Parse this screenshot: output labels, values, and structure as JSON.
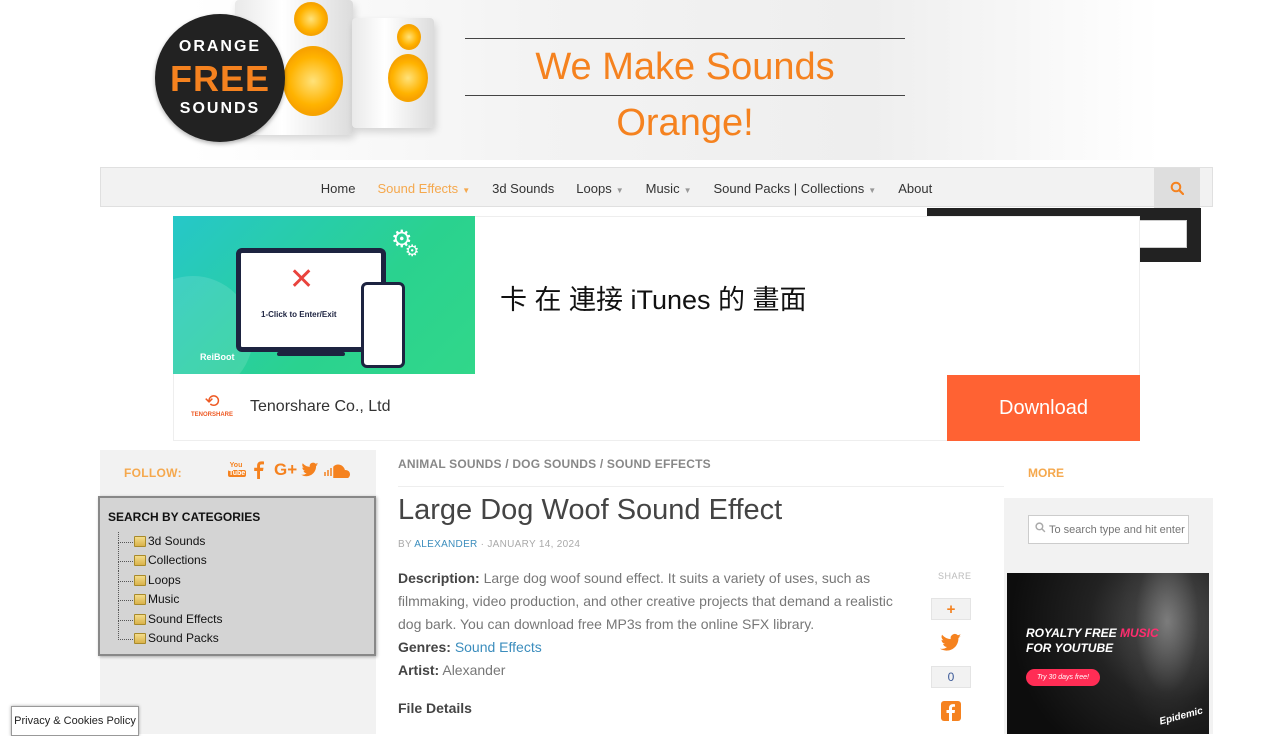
{
  "header": {
    "logo_line1": "ORANGE",
    "logo_line2": "FREE",
    "logo_line3": "SOUNDS",
    "tagline": "We Make Sounds Orange!"
  },
  "nav": {
    "items": [
      {
        "label": "Home",
        "has_dropdown": false,
        "active": false
      },
      {
        "label": "Sound Effects",
        "has_dropdown": true,
        "active": true
      },
      {
        "label": "3d Sounds",
        "has_dropdown": false,
        "active": false
      },
      {
        "label": "Loops",
        "has_dropdown": true,
        "active": false
      },
      {
        "label": "Music",
        "has_dropdown": true,
        "active": false
      },
      {
        "label": "Sound Packs | Collections",
        "has_dropdown": true,
        "active": false
      },
      {
        "label": "About",
        "has_dropdown": false,
        "active": false
      }
    ],
    "search_placeholder": "To search type and hit enter",
    "accent_color": "#f5a84d"
  },
  "ad": {
    "image_caption": "1-Click to Enter/Exit",
    "image_brand": "ReiBoot",
    "title": "卡 在 連接 iTunes 的 畫面",
    "company_logo_text": "TENORSHARE",
    "company": "Tenorshare Co., Ltd",
    "cta": "Download",
    "cta_color": "#ff6233"
  },
  "follow": {
    "label": "FOLLOW:",
    "youtube_top": "You",
    "youtube_bottom": "Tube",
    "google_plus": "G+",
    "icons": [
      "youtube-icon",
      "facebook-icon",
      "google-plus-icon",
      "twitter-icon",
      "soundcloud-icon"
    ]
  },
  "categories": {
    "title": "SEARCH BY CATEGORIES",
    "items": [
      "3d Sounds",
      "Collections",
      "Loops",
      "Music",
      "Sound Effects",
      "Sound Packs"
    ]
  },
  "cookie_label": "Privacy & Cookies Policy",
  "post": {
    "breadcrumb": "ANIMAL SOUNDS / DOG SOUNDS / SOUND EFFECTS",
    "title": "Large Dog Woof Sound Effect",
    "by": "BY ",
    "author": "ALEXANDER",
    "date": " · JANUARY 14, 2024",
    "description_label": "Description:",
    "description": " Large dog woof sound effect. It suits a variety of uses, such as filmmaking, video production, and other creative projects that demand a realistic dog bark. You can download free MP3s from the online SFX library.",
    "genres_label": "Genres:",
    "genres_value": "Sound Effects",
    "artist_label": "Artist:",
    "artist_value": " Alexander",
    "file_details": "File Details"
  },
  "share": {
    "label": "SHARE",
    "plus": "+",
    "count": "0"
  },
  "right": {
    "more_label": "MORE",
    "search_placeholder": "To search type and hit enter",
    "ad_line1_a": "ROYALTY FREE ",
    "ad_line1_b": "MUSIC",
    "ad_line2": "FOR YOUTUBE",
    "ad_button": "Try 30 days free!",
    "ad_brand": "Epidemic"
  }
}
